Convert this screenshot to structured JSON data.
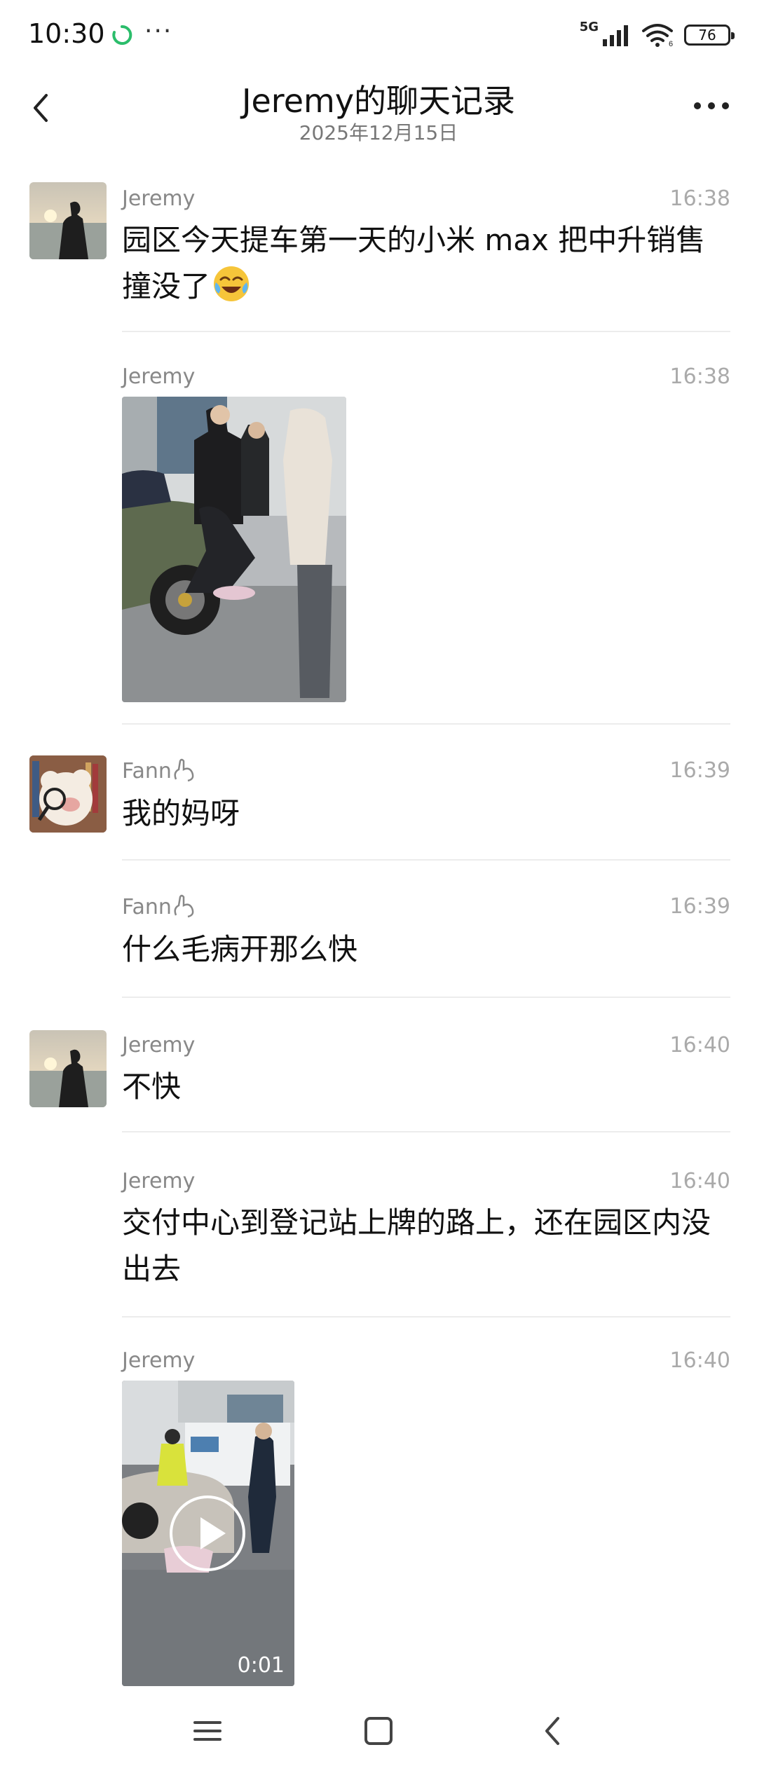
{
  "status_bar": {
    "time": "10:30",
    "dots": "···",
    "network": "5G",
    "battery": "76"
  },
  "header": {
    "title": "Jeremy的聊天记录",
    "date": "2025年12月15日"
  },
  "messages": [
    {
      "sender": "Jeremy",
      "time": "16:38",
      "text": "园区今天提车第一天的小米 max 把中升销售撞没了",
      "emoji": "crying-laughing-emoji"
    },
    {
      "sender": "Jeremy",
      "time": "16:38",
      "type": "image"
    },
    {
      "sender": "Fann",
      "time": "16:39",
      "text": "我的妈呀"
    },
    {
      "sender": "Fann",
      "time": "16:39",
      "text": "什么毛病开那么快"
    },
    {
      "sender": "Jeremy",
      "time": "16:40",
      "text": "不快"
    },
    {
      "sender": "Jeremy",
      "time": "16:40",
      "text": "交付中心到登记站上牌的路上，还在园区内没出去"
    },
    {
      "sender": "Jeremy",
      "time": "16:40",
      "type": "video",
      "duration": "0:01"
    }
  ],
  "colors": {
    "name": "#888888",
    "time": "#aaaaaa",
    "divider": "#ececec",
    "app_icon": "#2bbd6b"
  }
}
